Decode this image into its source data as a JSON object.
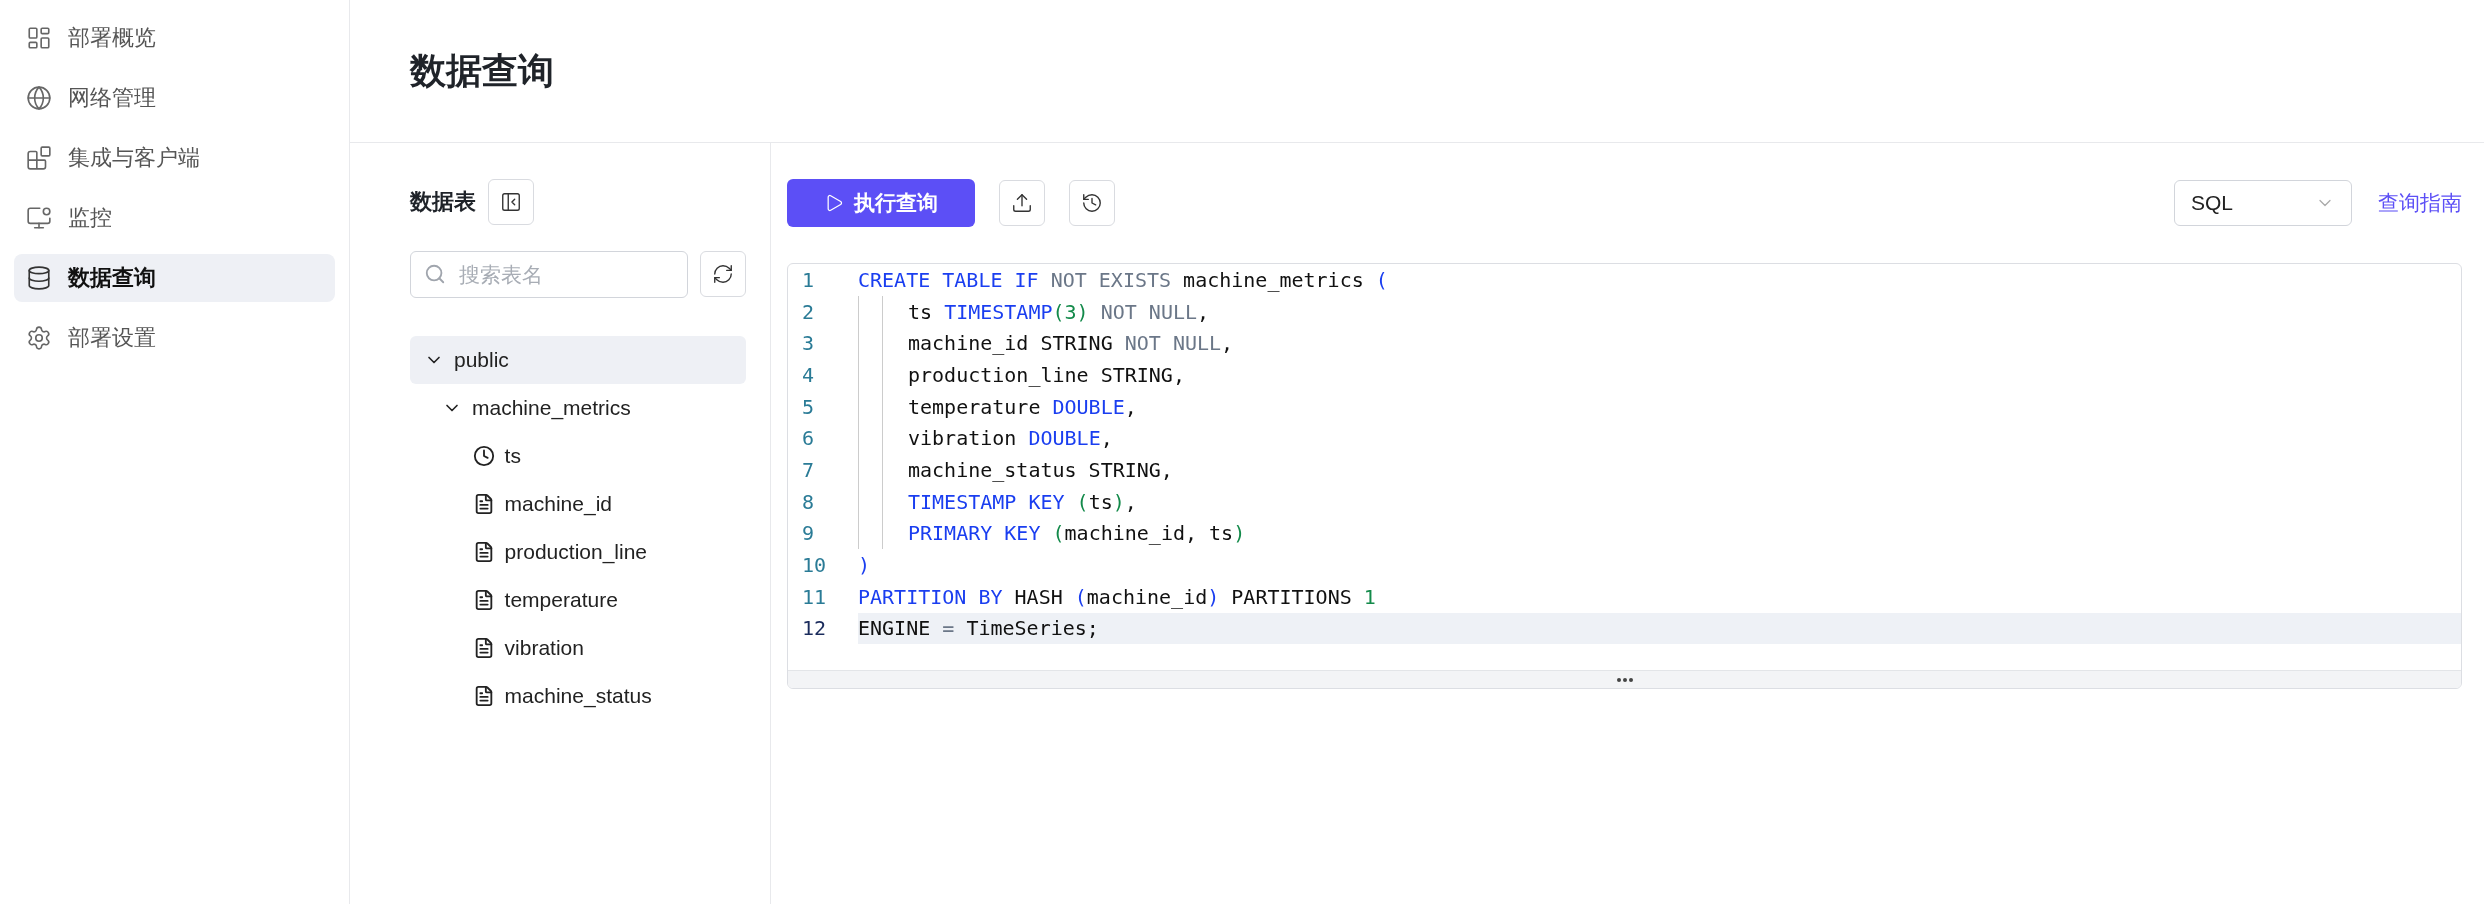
{
  "sidebar": {
    "items": [
      {
        "label": "部署概览",
        "selected": false
      },
      {
        "label": "网络管理",
        "selected": false
      },
      {
        "label": "集成与客户端",
        "selected": false
      },
      {
        "label": "监控",
        "selected": false
      },
      {
        "label": "数据查询",
        "selected": true
      },
      {
        "label": "部署设置",
        "selected": false
      }
    ]
  },
  "page": {
    "title": "数据查询"
  },
  "tables_panel": {
    "title": "数据表",
    "search": {
      "placeholder": "搜索表名"
    },
    "tree": [
      {
        "label": "public",
        "kind": "schema",
        "expanded": true,
        "selected": true,
        "children": [
          {
            "label": "machine_metrics",
            "kind": "table",
            "expanded": true,
            "selected": false,
            "children": [
              {
                "label": "ts",
                "kind": "time",
                "selected": false
              },
              {
                "label": "machine_id",
                "kind": "field",
                "selected": false
              },
              {
                "label": "production_line",
                "kind": "field",
                "selected": false
              },
              {
                "label": "temperature",
                "kind": "field",
                "selected": false
              },
              {
                "label": "vibration",
                "kind": "field",
                "selected": false
              },
              {
                "label": "machine_status",
                "kind": "field",
                "selected": false
              }
            ]
          }
        ]
      }
    ]
  },
  "toolbar": {
    "run_button": "执行查询",
    "language": "SQL",
    "guide_link": "查询指南"
  },
  "editor": {
    "lines": [
      {
        "number": "1",
        "indent": false,
        "active": false,
        "tokens": [
          {
            "kind": "kw",
            "text": "CREATE TABLE IF "
          },
          {
            "kind": "mod",
            "text": "NOT EXISTS "
          },
          {
            "kind": "plain",
            "text": "machine_metrics "
          },
          {
            "kind": "bracket",
            "text": "("
          }
        ]
      },
      {
        "number": "2",
        "indent": true,
        "active": false,
        "tokens": [
          {
            "kind": "plain",
            "text": "ts "
          },
          {
            "kind": "kw",
            "text": "TIMESTAMP"
          },
          {
            "kind": "paren",
            "text": "("
          },
          {
            "kind": "num",
            "text": "3"
          },
          {
            "kind": "paren",
            "text": ") "
          },
          {
            "kind": "mod",
            "text": "NOT NULL"
          },
          {
            "kind": "plain",
            "text": ","
          }
        ]
      },
      {
        "number": "3",
        "indent": true,
        "active": false,
        "tokens": [
          {
            "kind": "plain",
            "text": "machine_id STRING "
          },
          {
            "kind": "mod",
            "text": "NOT NULL"
          },
          {
            "kind": "plain",
            "text": ","
          }
        ]
      },
      {
        "number": "4",
        "indent": true,
        "active": false,
        "tokens": [
          {
            "kind": "plain",
            "text": "production_line STRING,"
          }
        ]
      },
      {
        "number": "5",
        "indent": true,
        "active": false,
        "tokens": [
          {
            "kind": "plain",
            "text": "temperature "
          },
          {
            "kind": "kw",
            "text": "DOUBLE"
          },
          {
            "kind": "plain",
            "text": ","
          }
        ]
      },
      {
        "number": "6",
        "indent": true,
        "active": false,
        "tokens": [
          {
            "kind": "plain",
            "text": "vibration "
          },
          {
            "kind": "kw",
            "text": "DOUBLE"
          },
          {
            "kind": "plain",
            "text": ","
          }
        ]
      },
      {
        "number": "7",
        "indent": true,
        "active": false,
        "tokens": [
          {
            "kind": "plain",
            "text": "machine_status STRING,"
          }
        ]
      },
      {
        "number": "8",
        "indent": true,
        "active": false,
        "tokens": [
          {
            "kind": "kw",
            "text": "TIMESTAMP KEY "
          },
          {
            "kind": "paren",
            "text": "("
          },
          {
            "kind": "plain",
            "text": "ts"
          },
          {
            "kind": "paren",
            "text": ")"
          },
          {
            "kind": "plain",
            "text": ","
          }
        ]
      },
      {
        "number": "9",
        "indent": true,
        "active": false,
        "tokens": [
          {
            "kind": "kw",
            "text": "PRIMARY KEY "
          },
          {
            "kind": "paren",
            "text": "("
          },
          {
            "kind": "plain",
            "text": "machine_id, ts"
          },
          {
            "kind": "paren",
            "text": ")"
          }
        ]
      },
      {
        "number": "10",
        "indent": false,
        "active": false,
        "tokens": [
          {
            "kind": "bracket",
            "text": ")"
          }
        ]
      },
      {
        "number": "11",
        "indent": false,
        "active": false,
        "tokens": [
          {
            "kind": "kw",
            "text": "PARTITION BY "
          },
          {
            "kind": "plain",
            "text": "HASH "
          },
          {
            "kind": "bracket",
            "text": "("
          },
          {
            "kind": "plain",
            "text": "machine_id"
          },
          {
            "kind": "bracket",
            "text": ")"
          },
          {
            "kind": "plain",
            "text": " PARTITIONS "
          },
          {
            "kind": "num",
            "text": "1"
          }
        ]
      },
      {
        "number": "12",
        "indent": false,
        "active": true,
        "tokens": [
          {
            "kind": "plain",
            "text": "ENGINE "
          },
          {
            "kind": "mod",
            "text": "="
          },
          {
            "kind": "plain",
            "text": " TimeSeries;"
          }
        ]
      }
    ]
  }
}
